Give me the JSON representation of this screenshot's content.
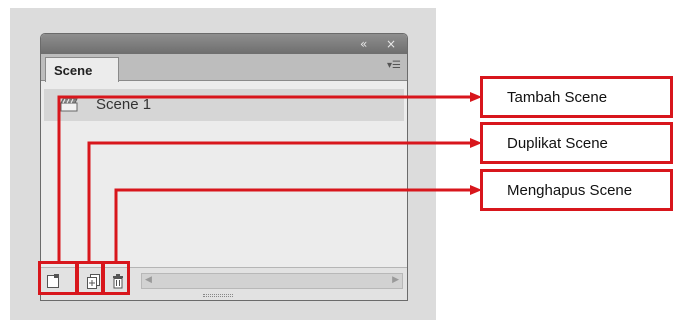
{
  "panel": {
    "collapse_glyph": "«",
    "close_glyph": "×",
    "tab_label": "Scene",
    "menu_glyph": "▾☰",
    "scenes": [
      {
        "label": "Scene 1",
        "icon": "scene-clapper-icon"
      }
    ],
    "buttons": [
      {
        "name": "add-scene-button",
        "icon": "add-scene-icon"
      },
      {
        "name": "duplicate-scene-button",
        "icon": "duplicate-scene-icon"
      },
      {
        "name": "delete-scene-button",
        "icon": "trash-icon"
      }
    ],
    "scroll_left_glyph": "◀",
    "scroll_right_glyph": "▶"
  },
  "annotations": {
    "callouts": [
      {
        "label": "Tambah Scene"
      },
      {
        "label": "Duplikat Scene"
      },
      {
        "label": "Menghapus Scene"
      }
    ],
    "color": "#d8161c"
  }
}
